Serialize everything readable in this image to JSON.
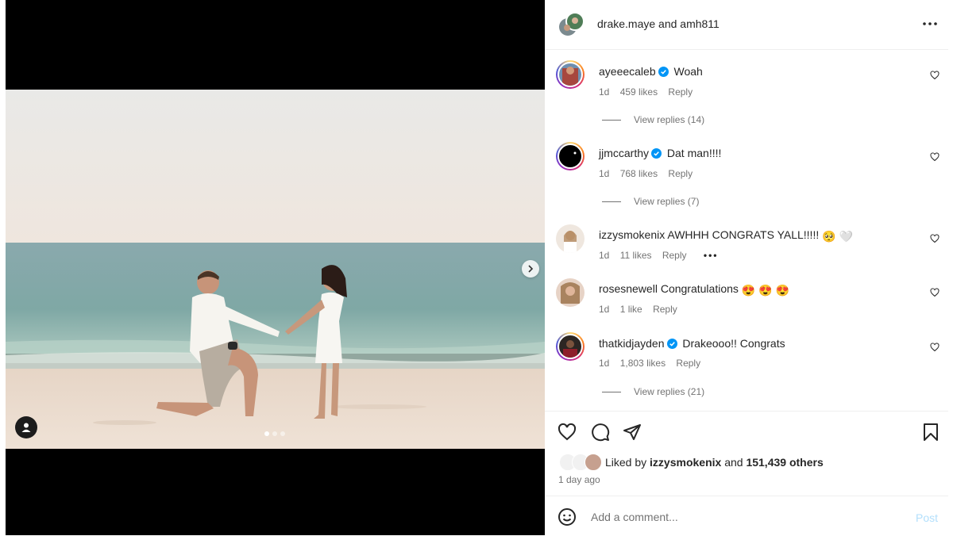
{
  "post": {
    "header": {
      "title": "drake.maye and amh811",
      "more_icon": "more-horizontal-icon"
    },
    "carousel": {
      "count": 3,
      "active": 1
    }
  },
  "comments": [
    {
      "user": "ayeeecaleb",
      "verified": true,
      "text": "Woah",
      "time": "1d",
      "likes": "459 likes",
      "reply": "Reply",
      "view_replies": "View replies (14)"
    },
    {
      "user": "jjmccarthy",
      "verified": true,
      "text": "Dat man!!!!",
      "time": "1d",
      "likes": "768 likes",
      "reply": "Reply",
      "view_replies": "View replies (7)"
    },
    {
      "user": "izzysmokenix",
      "verified": false,
      "text": "AWHHH CONGRATS YALL!!!!!",
      "time": "1d",
      "likes": "11 likes",
      "reply": "Reply",
      "emojis": [
        "🥺",
        "🤍"
      ]
    },
    {
      "user": "rosesnewell",
      "verified": false,
      "text": "Congratulations",
      "time": "1d",
      "likes": "1 like",
      "reply": "Reply",
      "emojis": [
        "😍",
        "😍",
        "😍"
      ]
    },
    {
      "user": "thatkidjayden",
      "verified": true,
      "text": "Drakeooo!! Congrats",
      "time": "1d",
      "likes": "1,803 likes",
      "reply": "Reply",
      "view_replies": "View replies (21)"
    }
  ],
  "likes": {
    "prefix": "Liked by",
    "user": "izzysmokenix",
    "joiner": "and",
    "others": "151,439 others"
  },
  "timestamp": "1 day ago",
  "add_comment": {
    "placeholder": "Add a comment...",
    "post_label": "Post"
  },
  "colors": {
    "verified": "#0095f6",
    "muted": "#737373",
    "post_disabled": "#b2dffc"
  }
}
